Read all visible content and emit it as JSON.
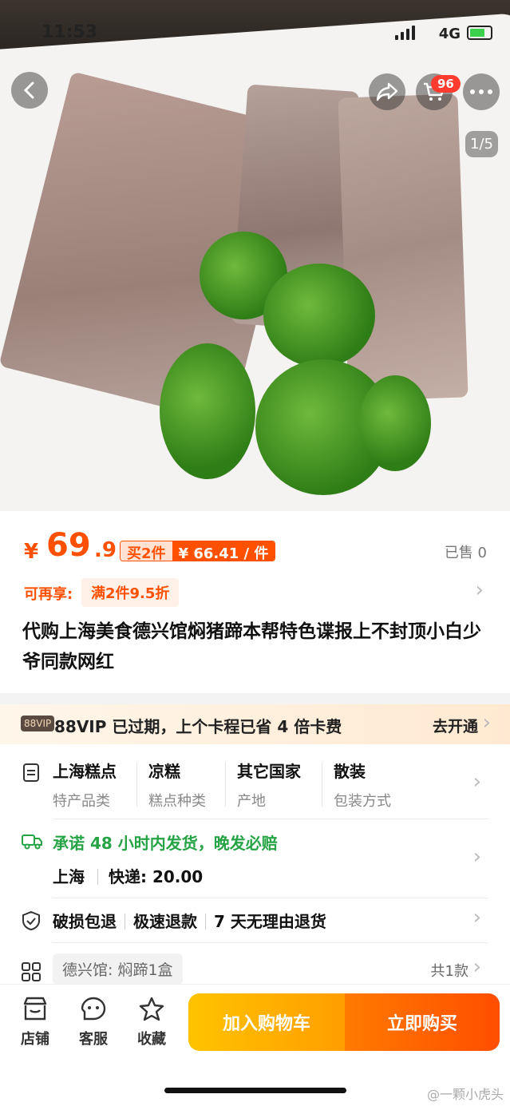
{
  "status": {
    "time": "11:53",
    "network": "4G"
  },
  "gallery": {
    "pager": "1/5",
    "cart_badge": "96"
  },
  "price": {
    "currency": "¥",
    "integer": "69",
    "decimal": ".9",
    "multi_buy_label": "买2件",
    "multi_buy_price": "¥ 66.41 / 件",
    "sold": "已售 0"
  },
  "promo": {
    "label": "可再享:",
    "tag": "满2件9.5折"
  },
  "product_title": "代购上海美食德兴馆焖猪蹄本帮特色谍报上不封顶小白少爷同款网红",
  "vip": {
    "logo": "88VIP",
    "text": "88VIP 已过期，上个卡程已省 4 倍卡费",
    "action": "去开通"
  },
  "attributes": [
    {
      "value": "上海糕点",
      "key": "特产品类"
    },
    {
      "value": "凉糕",
      "key": "糕点种类"
    },
    {
      "value": "其它国家",
      "key": "产地"
    },
    {
      "value": "散装",
      "key": "包装方式"
    }
  ],
  "shipping": {
    "promise": "承诺 48 小时内发货，晚发必赔",
    "origin": "上海",
    "express": "快递: 20.00"
  },
  "guarantees": [
    "破损包退",
    "极速退款",
    "7 天无理由退货"
  ],
  "sku": {
    "chip": "德兴馆: 焖蹄1盒",
    "count": "共1款"
  },
  "bottom_bar": {
    "store": "店铺",
    "service": "客服",
    "favorite": "收藏",
    "add_to_cart": "加入购物车",
    "buy_now": "立即购买"
  },
  "watermark": "@一颗小虎头",
  "colors": {
    "accent": "#ff5000",
    "green": "#26a345"
  }
}
